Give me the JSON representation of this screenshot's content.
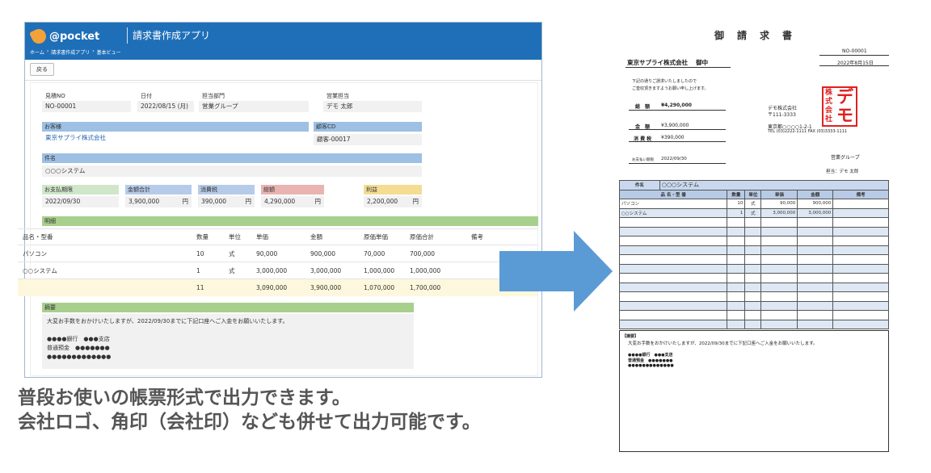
{
  "app": {
    "logo_text": "@pocket",
    "title": "請求書作成アプリ",
    "breadcrumb": [
      "ホーム",
      "›",
      "請求書作成アプリ",
      "›",
      "基本ビュー"
    ],
    "back_label": "戻る",
    "header_color": "#1f6fb8"
  },
  "form": {
    "row1": [
      {
        "label": "見積NO",
        "value": "NO-00001"
      },
      {
        "label": "日付",
        "value": "2022/08/15 (月)"
      },
      {
        "label": "担当部門",
        "value": "営業グループ"
      },
      {
        "label": "営業担当",
        "value": "デモ 太郎"
      }
    ],
    "customer": {
      "label": "お客様",
      "value": "東京サプライ株式会社"
    },
    "customer_cd": {
      "label": "顧客CD",
      "value": "顧客-00017"
    },
    "subject": {
      "label": "件名",
      "value": "○○○システム"
    },
    "summary": [
      {
        "label": "お支払期限",
        "value": "2022/09/30",
        "unit": ""
      },
      {
        "label": "金額合計",
        "value": "3,900,000",
        "unit": "円"
      },
      {
        "label": "消費税",
        "value": "390,000",
        "unit": "円"
      },
      {
        "label": "総額",
        "value": "4,290,000",
        "unit": "円"
      },
      {
        "label": "利益",
        "value": "2,200,000",
        "unit": "円"
      }
    ],
    "details_label": "明細",
    "details_columns": [
      "品名・型番",
      "数量",
      "単位",
      "単価",
      "金額",
      "原価単価",
      "原価合計",
      "備考"
    ],
    "details_rows": [
      [
        "パソコン",
        "10",
        "式",
        "90,000",
        "900,000",
        "70,000",
        "700,000",
        ""
      ],
      [
        "○○システム",
        "1",
        "式",
        "3,000,000",
        "3,000,000",
        "1,000,000",
        "1,000,000",
        ""
      ]
    ],
    "details_total": [
      "",
      "11",
      "",
      "3,090,000",
      "3,900,000",
      "1,070,000",
      "1,700,000",
      ""
    ],
    "memo_label": "摘要",
    "memo_lines": [
      "大変お手数をおかけいたしますが、2022/09/30までに下記口座へご入金をお願いいたします。",
      "",
      "●●●●銀行　●●●支店",
      "普通預金　●●●●●●●",
      "●●●●●●●●●●●●●"
    ]
  },
  "invoice": {
    "title": "御　請　求　書",
    "no": "NO-00001",
    "date": "2022年8月15日",
    "customer": "東京サプライ株式会社　 御中",
    "intro_lines": [
      "下記の通りご請求いたしましたので",
      "ご査収頂きますようお願い申し上げます。"
    ],
    "total_label": "総　額",
    "total_value": "¥4,290,000",
    "amount_label": "金　額",
    "amount_value": "¥3,900,000",
    "tax_label": "消 費 税",
    "tax_value": "¥390,000",
    "due_label": "お支払い期限",
    "due_value": "2022/09/30",
    "company_lines": [
      "デモ株式会社",
      "〒111-3333",
      "東京都○○○○1-2-1",
      "TEL (03)2222-1111 FAX (03)3333-1111"
    ],
    "seal_text": [
      "株",
      "式",
      "会",
      "社",
      "デ",
      "モ"
    ],
    "group": "営業グループ",
    "rep": "担当：デモ 太郎",
    "subject_label": "件名",
    "subject_value": "○○○システム",
    "columns": [
      "品 名・型 番",
      "数量",
      "単位",
      "単価",
      "金額",
      "備考"
    ],
    "rows": [
      [
        "パソコン",
        "10",
        "式",
        "90,000",
        "900,000",
        ""
      ],
      [
        "○○システム",
        "1",
        "式",
        "3,000,000",
        "3,000,000",
        ""
      ]
    ],
    "memo_label": "【摘要】",
    "memo_lines": [
      "大変お手数をおかけいたしますが、2022/09/30までに下記口座へご入金をお願いいたします。",
      "",
      "●●●●銀行　●●●支店",
      "普通預金　●●●●●●●",
      "●●●●●●●●●●●●●"
    ]
  },
  "caption": {
    "line1": "普段お使いの帳票形式で出力できます。",
    "line2": "会社ロゴ、角印（会社印）なども併せて出力可能です。"
  },
  "colors": {
    "arrow": "#5b9bd5",
    "seal": "#e02020"
  }
}
